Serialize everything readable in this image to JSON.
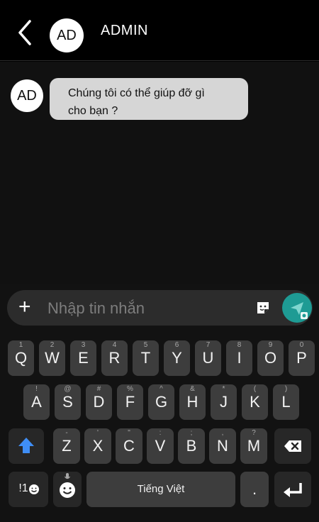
{
  "header": {
    "title": "ADMIN",
    "avatar_initials": "AD"
  },
  "chat": {
    "messages": [
      {
        "avatar_initials": "AD",
        "line1": "Chúng tôi có thể giúp đỡ gì",
        "line2": "cho bạn ?"
      }
    ]
  },
  "composer": {
    "placeholder": "Nhập tin nhắn",
    "plus": "+"
  },
  "keyboard": {
    "row1": [
      {
        "k": "Q",
        "h": "1"
      },
      {
        "k": "W",
        "h": "2"
      },
      {
        "k": "E",
        "h": "3"
      },
      {
        "k": "R",
        "h": "4"
      },
      {
        "k": "T",
        "h": "5"
      },
      {
        "k": "Y",
        "h": "6"
      },
      {
        "k": "U",
        "h": "7"
      },
      {
        "k": "I",
        "h": "8"
      },
      {
        "k": "O",
        "h": "9"
      },
      {
        "k": "P",
        "h": "0"
      }
    ],
    "row2": [
      {
        "k": "A",
        "h": "!"
      },
      {
        "k": "S",
        "h": "@"
      },
      {
        "k": "D",
        "h": "#"
      },
      {
        "k": "F",
        "h": "%"
      },
      {
        "k": "G",
        "h": "^"
      },
      {
        "k": "H",
        "h": "&"
      },
      {
        "k": "J",
        "h": "*"
      },
      {
        "k": "K",
        "h": "("
      },
      {
        "k": "L",
        "h": ")"
      }
    ],
    "row3": [
      {
        "k": "Z",
        "h": "-"
      },
      {
        "k": "X",
        "h": "'"
      },
      {
        "k": "C",
        "h": "\""
      },
      {
        "k": "V",
        "h": ":"
      },
      {
        "k": "B",
        "h": ";"
      },
      {
        "k": "N",
        "h": ","
      },
      {
        "k": "M",
        "h": "?"
      }
    ],
    "symbols_label": "!1",
    "space_label": "Tiếng Việt",
    "period_label": "."
  },
  "colors": {
    "send_button": "#1e9b94",
    "shift_arrow": "#3f8ef5",
    "bubble": "#d6d6d6"
  }
}
